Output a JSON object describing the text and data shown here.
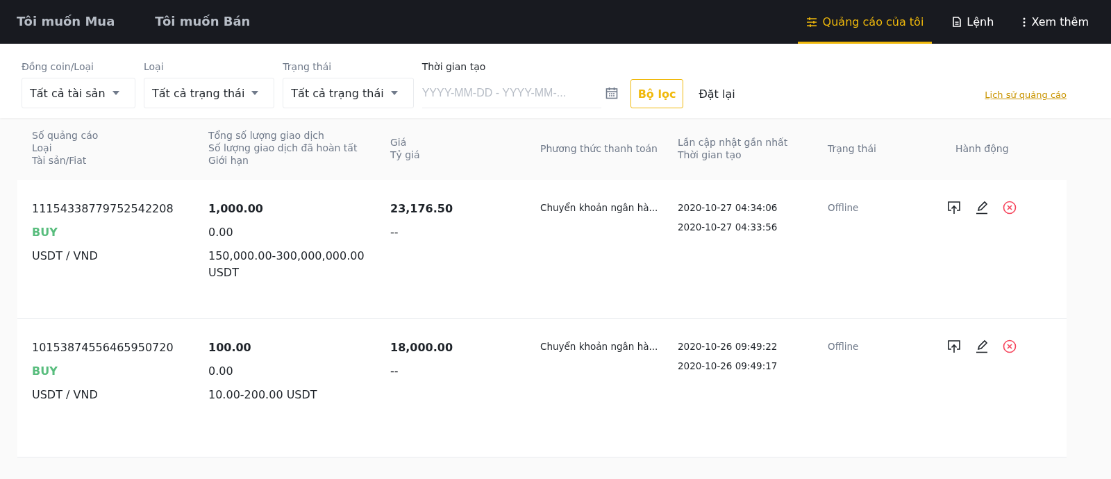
{
  "nav": {
    "left": [
      {
        "label": "Tôi muốn Mua",
        "selected": false
      },
      {
        "label": "Tôi muốn Bán",
        "selected": false
      }
    ],
    "right": [
      {
        "label": "Quảng cáo của tôi",
        "kind": "sliders",
        "selected": true
      },
      {
        "label": "Lệnh",
        "kind": "document",
        "selected": false
      },
      {
        "label": "Xem thêm",
        "kind": "dots",
        "selected": false
      }
    ]
  },
  "filters": {
    "selects": [
      {
        "label": "Đồng coin/Loại",
        "value": "Tất cả tài sản"
      },
      {
        "label": "Loại",
        "value": "Tất cả trạng thái"
      },
      {
        "label": "Trạng thái",
        "value": "Tất cả trạng thái"
      }
    ],
    "date": {
      "label": "Thời gian tạo",
      "placeholder": "YYYY-MM-DD - YYYY-MM-..."
    },
    "filter_button": "Bộ lọc",
    "reset_button": "Đặt lại",
    "history_link": "Lịch sử quảng cáo"
  },
  "table": {
    "columns": [
      [
        "Số quảng cáo",
        "Loại",
        "Tài sản/Fiat"
      ],
      [
        "Tổng số lượng giao dịch",
        "Số lượng giao dịch đã hoàn tất",
        "Giới hạn"
      ],
      [
        "Giá",
        "Tỷ giá"
      ],
      [
        "Phương thức thanh toán"
      ],
      [
        "Lần cập nhật gần nhất",
        "Thời gian tạo"
      ],
      [
        "Trạng thái"
      ],
      [
        "Hành động"
      ]
    ],
    "rows": [
      {
        "ad_number": "11154338779752542208",
        "type": "BUY",
        "pair": "USDT / VND",
        "total": "1,000.00",
        "completed": "0.00",
        "limit": "150,000.00-300,000,000.00 USDT",
        "price": "23,176.50",
        "rate": "--",
        "payment": "Chuyển khoản ngân hà...",
        "updated": "2020-10-27 04:34:06",
        "created": "2020-10-27 04:33:56",
        "status": "Offline"
      },
      {
        "ad_number": "10153874556465950720",
        "type": "BUY",
        "pair": "USDT / VND",
        "total": "100.00",
        "completed": "0.00",
        "limit": "10.00-200.00 USDT",
        "price": "18,000.00",
        "rate": "--",
        "payment": "Chuyển khoản ngân hà...",
        "updated": "2020-10-26 09:49:22",
        "created": "2020-10-26 09:49:17",
        "status": "Offline"
      }
    ]
  }
}
